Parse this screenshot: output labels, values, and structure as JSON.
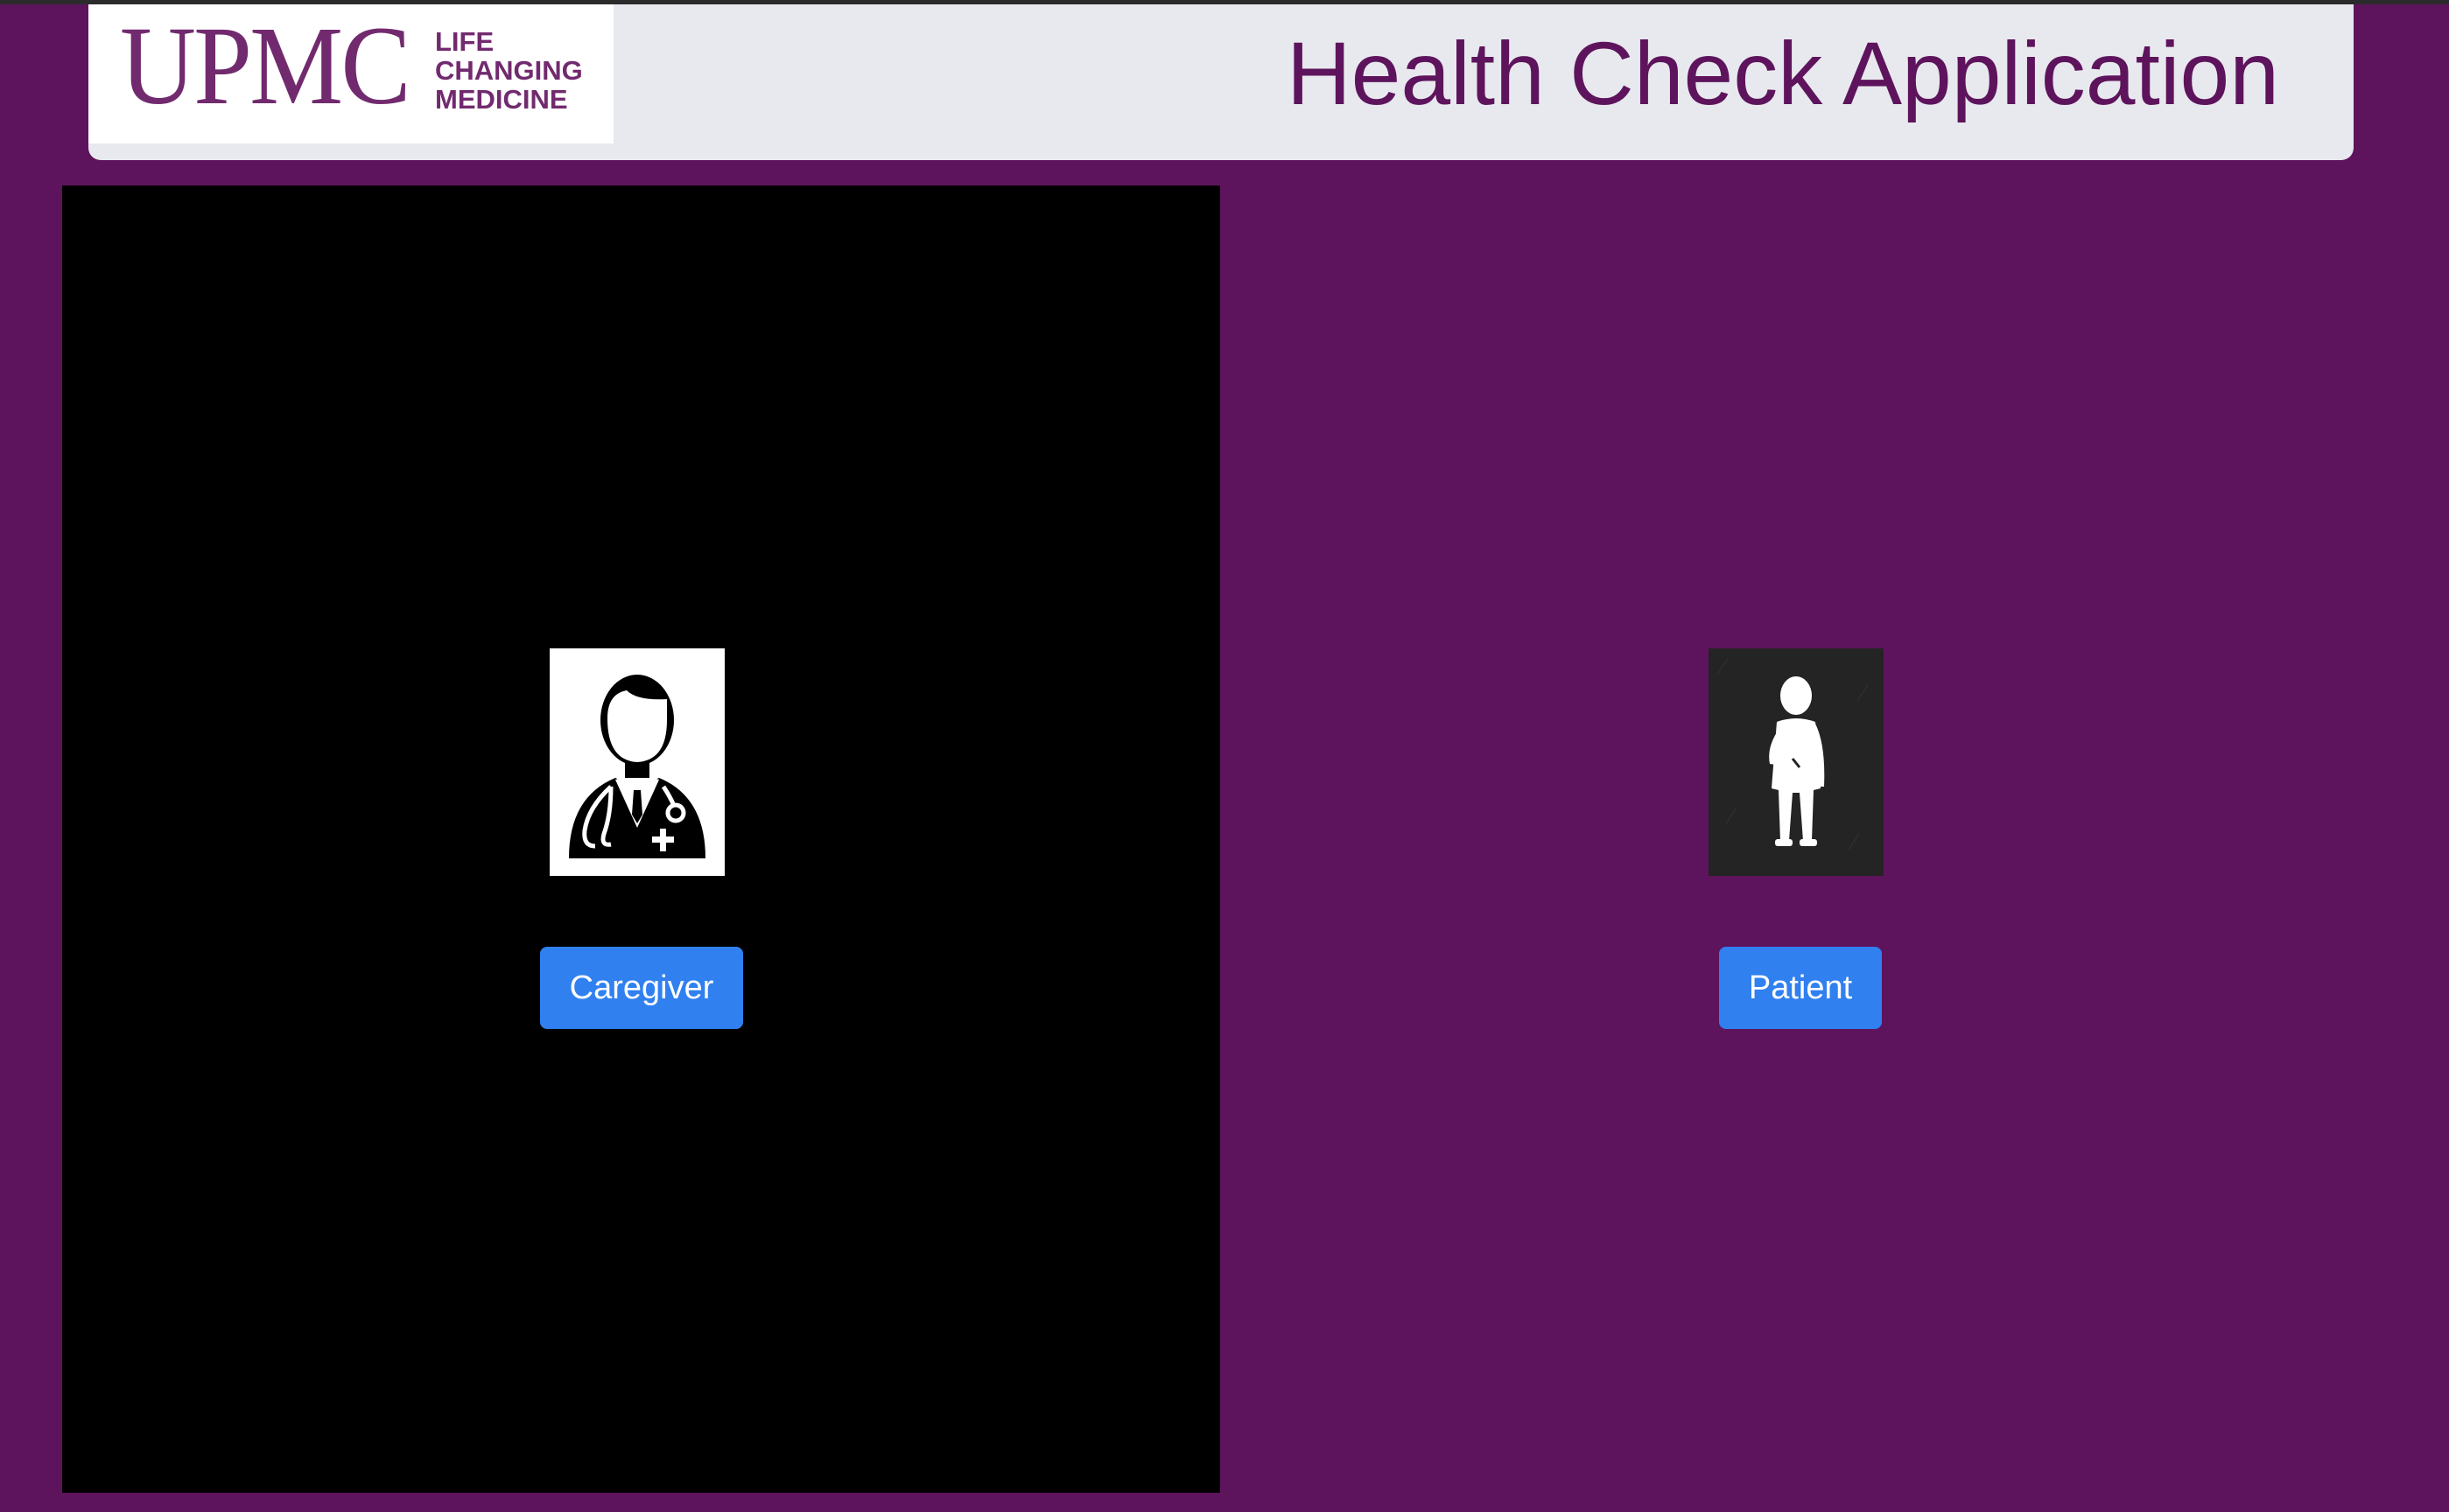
{
  "header": {
    "logo": {
      "wordmark": "UPMC",
      "tagline": [
        "LIFE",
        "CHANGING",
        "MEDICINE"
      ]
    },
    "title": "Health Check Application"
  },
  "roles": {
    "caregiver": {
      "icon": "doctor-icon",
      "button_label": "Caregiver"
    },
    "patient": {
      "icon": "patient-icon",
      "button_label": "Patient"
    }
  },
  "colors": {
    "page_background": "#5e145d",
    "header_background": "#e8e9ee",
    "brand_text": "#722a6f",
    "title_text": "#5e145d",
    "button_primary": "#3080f0",
    "caregiver_panel": "#000000"
  }
}
